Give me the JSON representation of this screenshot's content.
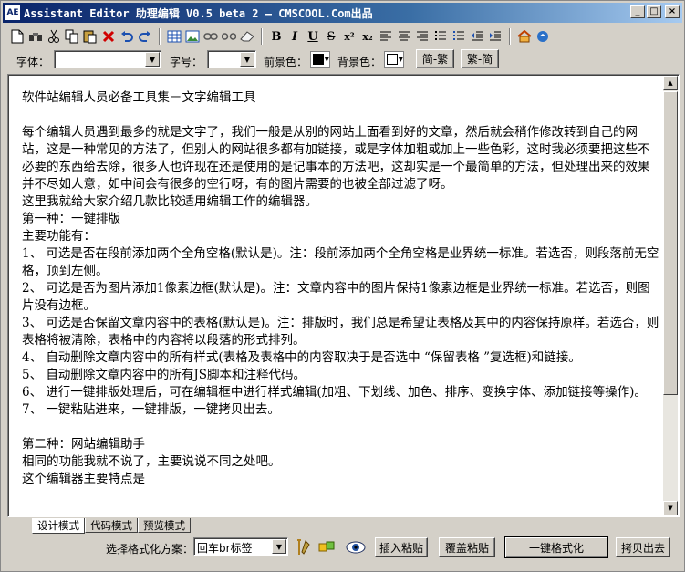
{
  "window": {
    "title": "Assistant Editor 助理编辑 V0.5 beta 2 — CMSCOOL.Com出品",
    "app_icon": "AE",
    "controls": {
      "minimize": "_",
      "maximize": "□",
      "close": "×"
    }
  },
  "toolbar1": {
    "icons": [
      "new-file-icon",
      "find-icon",
      "cut-icon",
      "copy-icon",
      "paste-icon",
      "delete-icon",
      "undo-icon",
      "redo-icon",
      "table-icon",
      "image-icon",
      "link-icon",
      "unlink-icon",
      "eraser-icon",
      "bold-icon",
      "italic-icon",
      "underline-icon",
      "strikethrough-icon",
      "superscript-icon",
      "subscript-icon",
      "align-left-icon",
      "align-center-icon",
      "align-right-icon",
      "unordered-list-icon",
      "ordered-list-icon",
      "outdent-icon",
      "indent-icon",
      "home-icon",
      "about-icon"
    ],
    "text_buttons": {
      "bold": "B",
      "italic": "I",
      "underline": "U",
      "strike": "S",
      "sup": "x²",
      "sub": "x₂"
    }
  },
  "toolbar2": {
    "font_label": "字体：",
    "font_value": "",
    "size_label": "字号：",
    "size_value": "",
    "fg_label": "前景色：",
    "fg_color": "#000000",
    "bg_label": "背景色：",
    "bg_color": "#ffffff",
    "to_simplified": "简-繁",
    "to_traditional": "繁-简"
  },
  "editor": {
    "paragraphs": [
      "软件站编辑人员必备工具集－文字编辑工具",
      "",
      "每个编辑人员遇到最多的就是文字了，我们一般是从别的网站上面看到好的文章，然后就会稍作修改转到自己的网站，这是一种常见的方法了，但别人的网站很多都有加链接，或是字体加粗或加上一些色彩，这时我必须要把这些不必要的东西给去除，很多人也许现在还是使用的是记事本的方法吧，这却实是一个最简单的方法，但处理出来的效果并不尽如人意，如中间会有很多的空行呀，有的图片需要的也被全部过滤了呀。",
      "这里我就给大家介绍几款比较适用编辑工作的编辑器。",
      "第一种：一键排版",
      "主要功能有：",
      "1、 可选是否在段前添加两个全角空格(默认是)。注：段前添加两个全角空格是业界统一标准。若选否，则段落前无空格，顶到左侧。",
      "2、 可选是否为图片添加1像素边框(默认是)。注：文章内容中的图片保持1像素边框是业界统一标准。若选否，则图片没有边框。",
      "3、 可选是否保留文章内容中的表格(默认是)。注：排版时，我们总是希望让表格及其中的内容保持原样。若选否，则表格将被清除，表格中的内容将以段落的形式排列。",
      "4、 自动删除文章内容中的所有样式(表格及表格中的内容取决于是否选中 “保留表格 ”复选框)和链接。",
      "5、 自动删除文章内容中的所有JS脚本和注释代码。",
      "6、 进行一键排版处理后，可在编辑框中进行样式编辑(加粗、下划线、加色、排序、变换字体、添加链接等操作)。",
      "7、 一键粘贴进来，一键排版，一键拷贝出去。",
      "",
      "第二种：网站编辑助手",
      "相同的功能我就不说了，主要说说不同之处吧。",
      "这个编辑器主要特点是"
    ]
  },
  "tabs": [
    "设计模式",
    "代码模式",
    "预览模式"
  ],
  "bottom": {
    "scheme_label": "选择格式化方案：",
    "scheme_value": "回车br标签",
    "insert_paste": "插入粘贴",
    "overwrite_paste": "覆盖粘贴",
    "one_click_format": "一键格式化",
    "copy_out": "拷贝出去"
  }
}
